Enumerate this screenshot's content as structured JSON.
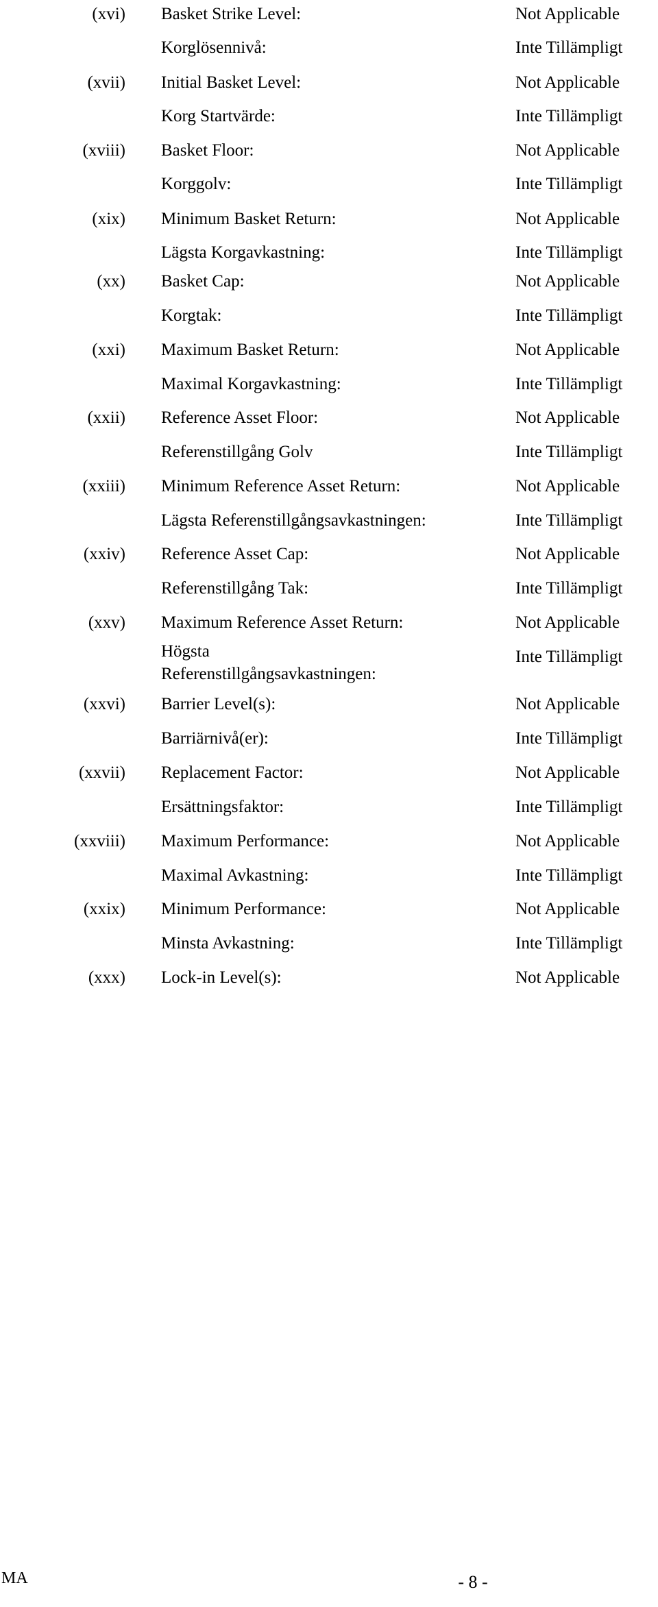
{
  "document": {
    "language_pairs": true,
    "english_value": "Not Applicable",
    "swedish_value": "Inte Tillämpligt"
  },
  "rows": [
    {
      "numeral": "(xvi)",
      "en_label": "Basket Strike Level:",
      "en_value": "Not Applicable",
      "sv_label": "Korglösennivå:",
      "sv_value": "Inte Tillämpligt"
    },
    {
      "numeral": "(xvii)",
      "en_label": "Initial Basket Level:",
      "en_value": "Not Applicable",
      "sv_label": "Korg Startvärde:",
      "sv_value": "Inte Tillämpligt"
    },
    {
      "numeral": "(xviii)",
      "en_label": "Basket Floor:",
      "en_value": "Not Applicable",
      "sv_label": "Korggolv:",
      "sv_value": "Inte Tillämpligt"
    },
    {
      "numeral": "(xix)",
      "en_label": "Minimum Basket Return:",
      "en_value": "Not Applicable",
      "sv_label": "Lägsta Korgavkastning:",
      "sv_value": "Inte Tillämpligt"
    },
    {
      "numeral": "(xx)",
      "en_label": "Basket Cap:",
      "en_value": "Not Applicable",
      "sv_label": "Korgtak:",
      "sv_value": "Inte Tillämpligt"
    },
    {
      "numeral": "(xxi)",
      "en_label": "Maximum Basket Return:",
      "en_value": "Not Applicable",
      "sv_label": "Maximal Korgavkastning:",
      "sv_value": "Inte Tillämpligt"
    },
    {
      "numeral": "(xxii)",
      "en_label": "Reference Asset Floor:",
      "en_value": "Not Applicable",
      "sv_label": "Referenstillgång Golv",
      "sv_value": "Inte Tillämpligt"
    },
    {
      "numeral": "(xxiii)",
      "en_label": "Minimum Reference Asset Return:",
      "en_value": "Not Applicable",
      "sv_label": "Lägsta Referenstillgångsavkastningen:",
      "sv_value": "Inte Tillämpligt"
    },
    {
      "numeral": "(xxiv)",
      "en_label": "Reference Asset Cap:",
      "en_value": "Not Applicable",
      "sv_label": "Referenstillgång Tak:",
      "sv_value": "Inte Tillämpligt"
    },
    {
      "numeral": "(xxv)",
      "en_label": "Maximum Reference Asset Return:",
      "en_value": "Not Applicable",
      "sv_label": "Högsta Referenstillgångsavkastningen:",
      "sv_value": "Inte Tillämpligt"
    },
    {
      "numeral": "(xxvi)",
      "en_label": "Barrier Level(s):",
      "en_value": "Not Applicable",
      "sv_label": "Barriärnivå(er):",
      "sv_value": "Inte Tillämpligt"
    },
    {
      "numeral": "(xxvii)",
      "en_label": "Replacement Factor:",
      "en_value": "Not Applicable",
      "sv_label": "Ersättningsfaktor:",
      "sv_value": "Inte Tillämpligt"
    },
    {
      "numeral": "(xxviii)",
      "en_label": "Maximum Performance:",
      "en_value": "Not Applicable",
      "sv_label": "Maximal Avkastning:",
      "sv_value": "Inte Tillämpligt"
    },
    {
      "numeral": "(xxix)",
      "en_label": "Minimum Performance:",
      "en_value": "Not Applicable",
      "sv_label": "Minsta Avkastning:",
      "sv_value": "Inte Tillämpligt"
    },
    {
      "numeral": "(xxx)",
      "en_label": "Lock-in Level(s):",
      "en_value": "Not Applicable",
      "sv_label": null,
      "sv_value": null
    }
  ],
  "footer": {
    "left_mark": "MA",
    "page_number": "- 8 -"
  }
}
